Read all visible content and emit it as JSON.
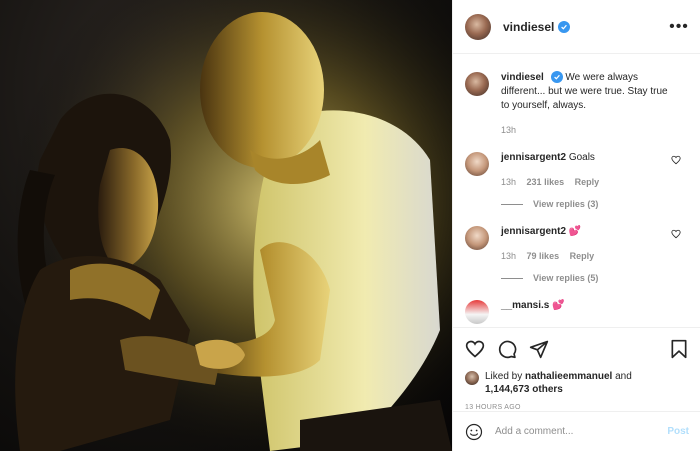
{
  "post": {
    "photo_alt": "",
    "author": "vindiesel",
    "verified": true
  },
  "caption": {
    "username": "vindiesel",
    "text": "We were always different... but we were true. Stay true to yourself, always.",
    "time": "13h"
  },
  "comments": [
    {
      "username": "jennisargent2",
      "text": "Goals",
      "time": "13h",
      "likes": "231 likes",
      "reply": "Reply",
      "view_replies": "View replies (3)"
    },
    {
      "username": "jennisargent2",
      "text": "💕",
      "time": "13h",
      "likes": "79 likes",
      "reply": "Reply",
      "view_replies": "View replies (5)"
    },
    {
      "username": "__mansi.s",
      "text": "💕",
      "time": "",
      "likes": "",
      "reply": "",
      "view_replies": ""
    }
  ],
  "likes": {
    "prefix": "Liked by",
    "user": "nathalieemmanuel",
    "and": "and",
    "others": "1,144,673 others"
  },
  "timestamp": "13 HOURS AGO",
  "add_comment": {
    "placeholder": "Add a comment...",
    "post_label": "Post"
  },
  "colors": {
    "accent": "#3897f0",
    "post_disabled": "#b2dffc",
    "muted": "#8e8e8e"
  },
  "icons": [
    "more-icon",
    "verified-icon",
    "heart-icon",
    "comment-icon",
    "share-icon",
    "bookmark-icon",
    "emoji-icon"
  ]
}
